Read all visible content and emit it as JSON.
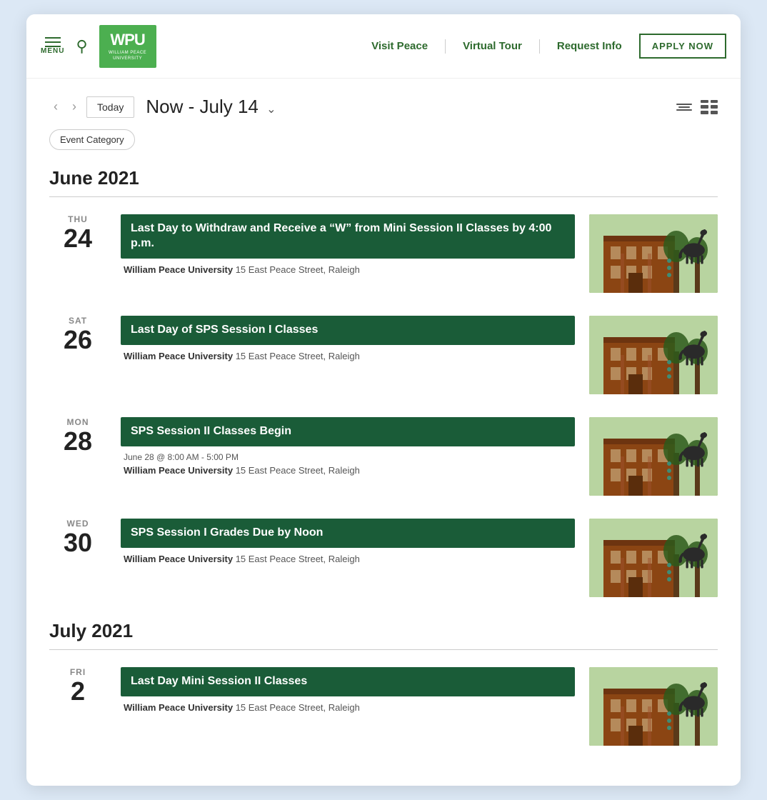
{
  "nav": {
    "menu_label": "MENU",
    "logo_text": "WPU",
    "logo_sub": "WILLIAM PEACE UNIVERSITY",
    "links": [
      {
        "label": "Visit Peace",
        "name": "visit-peace-link"
      },
      {
        "label": "Virtual Tour",
        "name": "virtual-tour-link"
      },
      {
        "label": "Request Info",
        "name": "request-info-link"
      }
    ],
    "apply_label": "APPLY NOW"
  },
  "calendar": {
    "date_range": "Now - July 14",
    "caret": "∨",
    "today_label": "Today",
    "event_category_label": "Event Category",
    "months": [
      {
        "name": "June 2021",
        "events": [
          {
            "day_name": "THU",
            "day_num": "24",
            "title": "Last Day to Withdraw and Receive a “W” from Mini Session II Classes by 4:00 p.m.",
            "time": "",
            "location": "William Peace University",
            "address": "15 East Peace Street, Raleigh"
          },
          {
            "day_name": "SAT",
            "day_num": "26",
            "title": "Last Day of SPS Session I Classes",
            "time": "",
            "location": "William Peace University",
            "address": "15 East Peace Street, Raleigh"
          },
          {
            "day_name": "MON",
            "day_num": "28",
            "title": "SPS Session II Classes Begin",
            "time": "June 28 @ 8:00 AM - 5:00 PM",
            "location": "William Peace University",
            "address": "15 East Peace Street, Raleigh"
          },
          {
            "day_name": "WED",
            "day_num": "30",
            "title": "SPS Session I Grades Due by Noon",
            "time": "",
            "location": "William Peace University",
            "address": "15 East Peace Street, Raleigh"
          }
        ]
      },
      {
        "name": "July 2021",
        "events": [
          {
            "day_name": "FRI",
            "day_num": "2",
            "title": "Last Day Mini Session II Classes",
            "time": "",
            "location": "William Peace University",
            "address": "15 East Peace Street, Raleigh"
          }
        ]
      }
    ]
  }
}
